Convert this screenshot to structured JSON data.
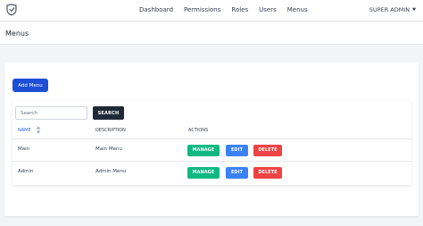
{
  "navbar": {
    "logo_icon": "shield-logo-icon",
    "links": [
      "Dashboard",
      "Permissions",
      "Roles",
      "Users",
      "Menus"
    ],
    "user_label": "SUPER ADMIN"
  },
  "header": {
    "title": "Menus"
  },
  "actions": {
    "add_label": "Add Menu"
  },
  "search": {
    "placeholder": "Search",
    "button_label": "SEARCH"
  },
  "table": {
    "columns": [
      "NAME",
      "DESCRIPTION",
      "ACTIONS"
    ],
    "rows": [
      {
        "name": "Main",
        "description": "Main Menu"
      },
      {
        "name": "Admin",
        "description": "Admin Menu"
      }
    ],
    "row_actions": [
      "MANAGE",
      "EDIT",
      "DELETE"
    ]
  },
  "colors": {
    "primary": "#1d4ed8",
    "dark": "#1f2937",
    "manage": "#10b981",
    "edit": "#3b82f6",
    "delete": "#ef4444"
  }
}
